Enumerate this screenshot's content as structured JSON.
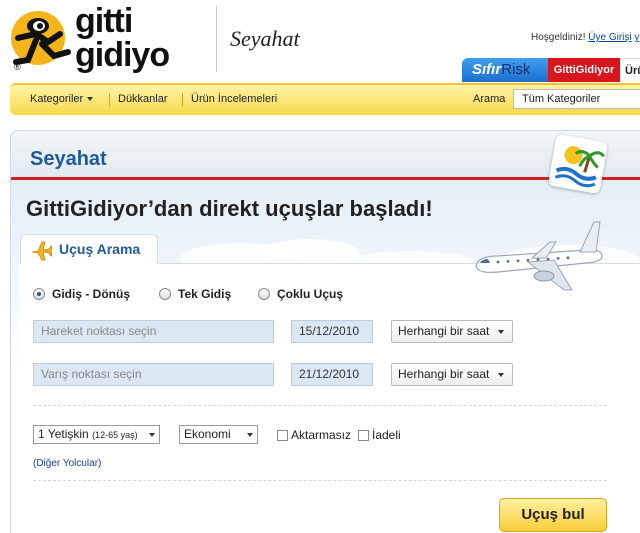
{
  "header": {
    "logo_line1": "gitti",
    "logo_line2": "gidiyo",
    "registered": "®",
    "section_title": "Seyahat",
    "greeting": "Hoşgeldiniz!",
    "signin_link": "Üye Girişi",
    "signin_suffix": "y"
  },
  "brand_tabs": {
    "sifir": "Sıfır",
    "risk": "Risk",
    "gittigidiyor": "GittiGidiyor",
    "uru": "Ürü"
  },
  "navbar": {
    "categories": "Kategoriler",
    "stores": "Dükkanlar",
    "reviews": "Ürün İncelemeleri",
    "search_label": "Arama",
    "search_select": "Tüm Kategoriler"
  },
  "panel": {
    "title": "Seyahat",
    "headline": "GittiGidiyor’dan direkt uçuşlar başladı!",
    "tab_label": "Uçuş Arama"
  },
  "trip_types": [
    {
      "label": "Gidiş - Dönüş",
      "selected": true
    },
    {
      "label": "Tek Gidiş",
      "selected": false
    },
    {
      "label": "Çoklu Uçuş",
      "selected": false
    }
  ],
  "form": {
    "origin_placeholder": "Hareket noktası seçin",
    "depart_date": "15/12/2010",
    "depart_time": "Herhangi bir saat",
    "destination_placeholder": "Varış noktası seçin",
    "return_date": "21/12/2010",
    "return_time": "Herhangi bir saat",
    "passengers": "1 Yetişkin",
    "passengers_note": "(12-65 yaş)",
    "cabin": "Ekonomi",
    "nonstop_label": "Aktarmasız",
    "refundable_label": "İadeli",
    "other_passengers": "(Diğer Yolcular)",
    "submit": "Uçuş bul"
  },
  "colors": {
    "accent_blue": "#1e5a9b",
    "brand_red": "#d31e26",
    "nav_yellow": "#f7d94a"
  }
}
